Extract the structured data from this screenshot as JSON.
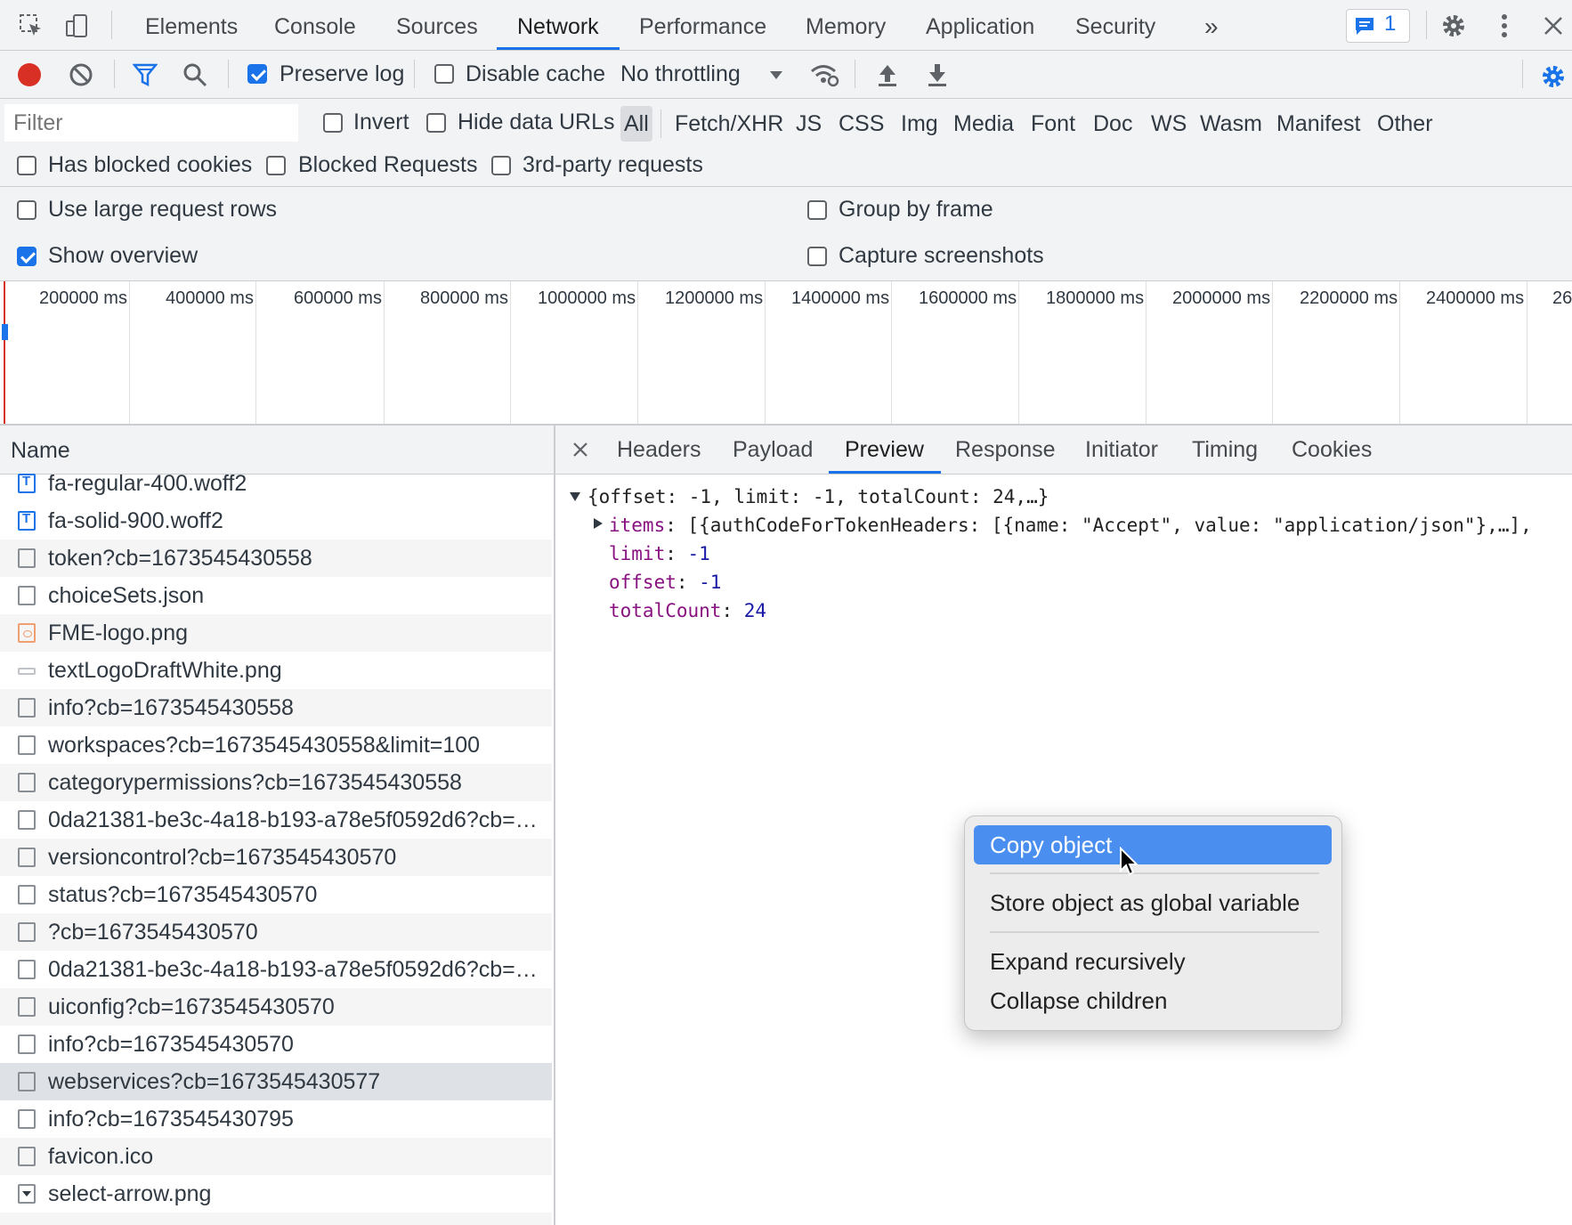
{
  "tabs": [
    {
      "label": "Elements"
    },
    {
      "label": "Console"
    },
    {
      "label": "Sources"
    },
    {
      "label": "Network"
    },
    {
      "label": "Performance"
    },
    {
      "label": "Memory"
    },
    {
      "label": "Application"
    },
    {
      "label": "Security"
    }
  ],
  "active_tab": "Network",
  "issues_badge": "1",
  "toolbar": {
    "preserve_log": "Preserve log",
    "disable_cache": "Disable cache",
    "throttling": "No throttling"
  },
  "filter": {
    "placeholder": "Filter",
    "invert": "Invert",
    "hide_data_urls": "Hide data URLs",
    "types": [
      "All",
      "Fetch/XHR",
      "JS",
      "CSS",
      "Img",
      "Media",
      "Font",
      "Doc",
      "WS",
      "Wasm",
      "Manifest",
      "Other"
    ],
    "selected_type": "All",
    "has_blocked_cookies": "Has blocked cookies",
    "blocked_requests": "Blocked Requests",
    "third_party": "3rd-party requests"
  },
  "settings": {
    "large_rows": "Use large request rows",
    "show_overview": "Show overview",
    "group_by_frame": "Group by frame",
    "capture_screenshots": "Capture screenshots"
  },
  "overview_ticks": [
    "200000 ms",
    "400000 ms",
    "600000 ms",
    "800000 ms",
    "1000000 ms",
    "1200000 ms",
    "1400000 ms",
    "1600000 ms",
    "1800000 ms",
    "2000000 ms",
    "2200000 ms",
    "2400000 ms",
    "26"
  ],
  "name_header": "Name",
  "requests": [
    {
      "name": "fa-regular-400.woff2",
      "icon": "font"
    },
    {
      "name": "fa-solid-900.woff2",
      "icon": "font"
    },
    {
      "name": "token?cb=1673545430558",
      "icon": "doc"
    },
    {
      "name": "choiceSets.json",
      "icon": "doc"
    },
    {
      "name": "FME-logo.png",
      "icon": "img"
    },
    {
      "name": "textLogoDraftWhite.png",
      "icon": "flat"
    },
    {
      "name": "info?cb=1673545430558",
      "icon": "doc"
    },
    {
      "name": "workspaces?cb=1673545430558&limit=100",
      "icon": "doc"
    },
    {
      "name": "categorypermissions?cb=1673545430558",
      "icon": "doc"
    },
    {
      "name": "0da21381-be3c-4a18-b193-a78e5f0592d6?cb=1…",
      "icon": "doc"
    },
    {
      "name": "versioncontrol?cb=1673545430570",
      "icon": "doc"
    },
    {
      "name": "status?cb=1673545430570",
      "icon": "doc"
    },
    {
      "name": "?cb=1673545430570",
      "icon": "doc"
    },
    {
      "name": "0da21381-be3c-4a18-b193-a78e5f0592d6?cb=1…",
      "icon": "doc"
    },
    {
      "name": "uiconfig?cb=1673545430570",
      "icon": "doc"
    },
    {
      "name": "info?cb=1673545430570",
      "icon": "doc"
    },
    {
      "name": "webservices?cb=1673545430577",
      "icon": "doc"
    },
    {
      "name": "info?cb=1673545430795",
      "icon": "doc"
    },
    {
      "name": "favicon.ico",
      "icon": "doc"
    },
    {
      "name": "select-arrow.png",
      "icon": "arrow"
    }
  ],
  "selected_request": "webservices?cb=1673545430577",
  "detail_tabs": [
    "Headers",
    "Payload",
    "Preview",
    "Response",
    "Initiator",
    "Timing",
    "Cookies"
  ],
  "active_detail_tab": "Preview",
  "preview": {
    "root": "{offset: -1, limit: -1, totalCount: 24,…}",
    "items_key": "items",
    "items_value": "[{authCodeForTokenHeaders: [{name: \"Accept\", value: \"application/json\"},…],",
    "limit_key": "limit",
    "limit_value": "-1",
    "offset_key": "offset",
    "offset_value": "-1",
    "total_key": "totalCount",
    "total_value": "24"
  },
  "context_menu": {
    "copy": "Copy object",
    "store": "Store object as global variable",
    "expand": "Expand recursively",
    "collapse": "Collapse children"
  },
  "colors": {
    "accent": "#1a73e8",
    "record": "#d93025",
    "menu_highlight": "#4a8ff0"
  }
}
